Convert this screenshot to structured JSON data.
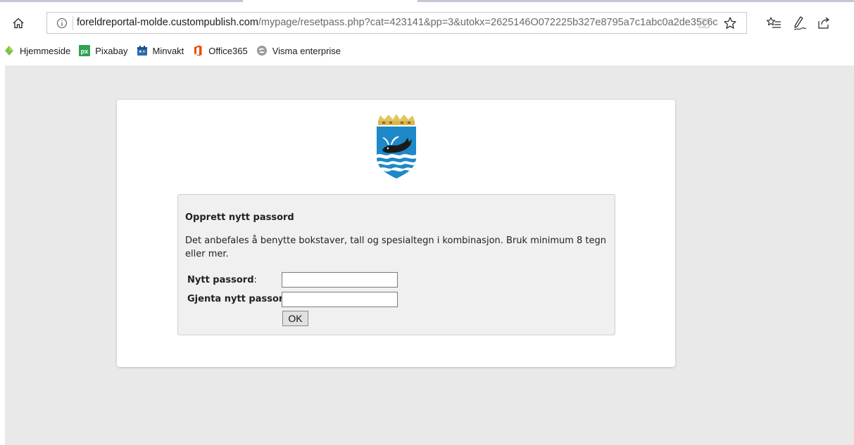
{
  "browser": {
    "url_host": "foreldreportal-molde.custompublish.com",
    "url_path": "/mypage/resetpass.php?cat=423141&pp=3&utokx=2625146O072225b327e8795a7c1abc0a2de35c6c",
    "icons": [
      "home-icon",
      "info-icon",
      "reading-view-icon",
      "favorite-star-icon",
      "favorites-list-icon",
      "pen-icon",
      "share-icon"
    ]
  },
  "favorites": [
    {
      "label": "Hjemmeside",
      "icon": "diamond-icon"
    },
    {
      "label": "Pixabay",
      "icon": "pixabay-icon"
    },
    {
      "label": "Minvakt",
      "icon": "minvakt-icon"
    },
    {
      "label": "Office365",
      "icon": "office-icon"
    },
    {
      "label": "Visma enterprise",
      "icon": "visma-icon"
    }
  ],
  "form": {
    "title": "Opprett nytt passord",
    "description": "Det anbefales å benytte bokstaver, tall og spesialtegn i kombinasjon. Bruk minimum 8 tegn eller mer.",
    "new_password_label": "Nytt passord",
    "repeat_password_label": "Gjenta nytt passord",
    "colon": ":",
    "new_password_value": "",
    "repeat_password_value": "",
    "ok_label": "OK"
  },
  "colors": {
    "page_bg": "#e9e9e9",
    "crest_blue": "#1e88c8",
    "crest_gold": "#d8b64a",
    "office_orange": "#e84c0e",
    "pixabay_green": "#2ea44f"
  }
}
